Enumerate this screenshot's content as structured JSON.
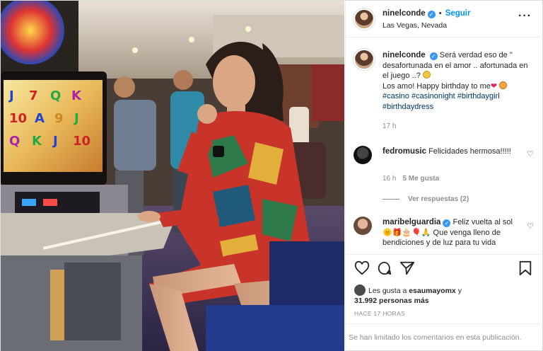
{
  "post": {
    "username": "ninelconde",
    "verified_glyph": "✓",
    "separator": "•",
    "follow_label": "Seguir",
    "location": "Las Vegas, Nevada",
    "more_icon": "···",
    "image_alt": "Woman in a colorful patterned dress sitting at a casino slot machine"
  },
  "caption": {
    "username": "ninelconde",
    "line1": "Será verdad eso de \" desafortunada en el amor .. afortunada en el juego ..?",
    "line2": "Los amo! Happy birthday to me",
    "heart_glyph": "❤",
    "hashtags": "#casino #casinonight #birthdaygirl #birthdaydress",
    "time": "17 h"
  },
  "comments": [
    {
      "username": "fedromusic",
      "text": "Felicidades hermosa!!!!!",
      "time": "16 h",
      "likes": "5 Me gusta",
      "like_icon": "♡",
      "view_replies": "Ver respuestas (2)"
    },
    {
      "username": "maribelguardia",
      "text": "Feliz vuelta al sol",
      "text2": "Que venga lleno de bendiciones y de luz para tu vida",
      "emojis": "🌞🎁🎂🎈🙏",
      "like_icon": "♡"
    }
  ],
  "actions": {
    "like_icon": "heart-outline-icon",
    "comment_icon": "comment-bubble-icon",
    "share_icon": "paper-plane-icon",
    "save_icon": "bookmark-icon"
  },
  "likes": {
    "prefix": "Les gusta a",
    "user": "esaumayomx",
    "conj": "y",
    "count": "31.992 personas más"
  },
  "date": "HACE 17 HORAS",
  "comments_limited": "Se han limitado los comentarios en esta publicación.",
  "colors": {
    "link_blue": "#0095f6",
    "verified_blue": "#3897f0",
    "hashtag": "#00376b",
    "muted": "#8e8e8e"
  }
}
